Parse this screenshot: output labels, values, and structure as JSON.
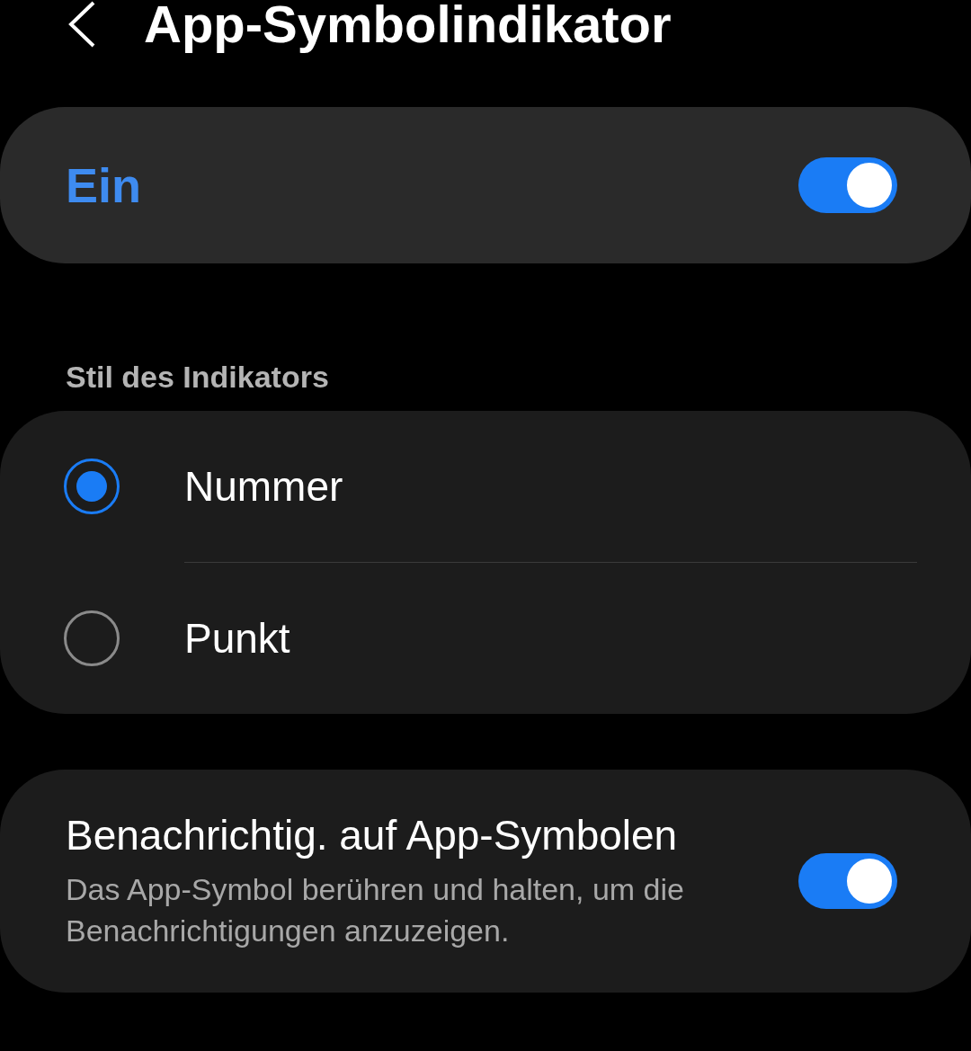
{
  "header": {
    "title": "App-Symbolindikator"
  },
  "master": {
    "label": "Ein",
    "on": true
  },
  "style_section": {
    "label": "Stil des Indikators",
    "options": [
      {
        "label": "Nummer",
        "selected": true
      },
      {
        "label": "Punkt",
        "selected": false
      }
    ]
  },
  "icon_notifications": {
    "title": "Benachrichtig. auf App-Symbolen",
    "description": "Das App-Symbol berühren und halten, um die Benachrichtigungen anzuzeigen.",
    "on": true
  }
}
